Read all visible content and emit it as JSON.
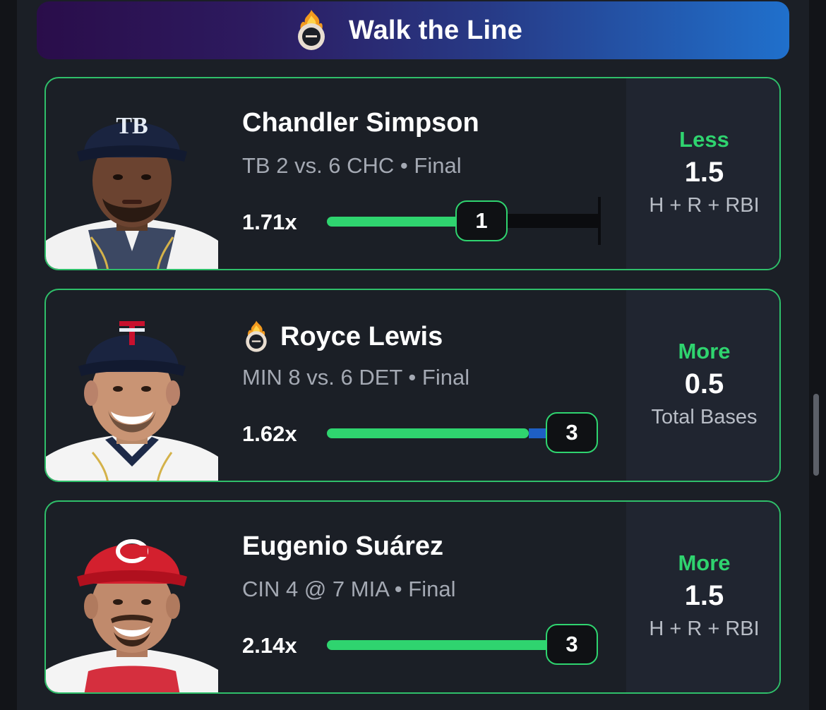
{
  "header": {
    "title": "Walk the Line",
    "icon": "flame-ring-icon"
  },
  "colors": {
    "accent_green": "#2fd46f",
    "card_border": "#2fbf6a",
    "muted_text": "#a4a9b3"
  },
  "picks": [
    {
      "player": "Chandler Simpson",
      "has_flame_icon": false,
      "game": "TB 2 vs. 6 CHC • Final",
      "multiplier": "1.71x",
      "current": "1",
      "progress": 0.67,
      "direction": "Less",
      "line": "1.5",
      "stat": "H + R + RBI",
      "team_logo": "TB"
    },
    {
      "player": "Royce Lewis",
      "has_flame_icon": true,
      "game": "MIN 8 vs. 6 DET • Final",
      "multiplier": "1.62x",
      "current": "3",
      "progress": 1.0,
      "direction": "More",
      "line": "0.5",
      "stat": "Total Bases",
      "team_logo": "TC"
    },
    {
      "player": "Eugenio Suárez",
      "has_flame_icon": false,
      "game": "CIN 4 @ 7 MIA • Final",
      "multiplier": "2.14x",
      "current": "3",
      "progress": 1.0,
      "direction": "More",
      "line": "1.5",
      "stat": "H + R + RBI",
      "team_logo": "C"
    }
  ]
}
